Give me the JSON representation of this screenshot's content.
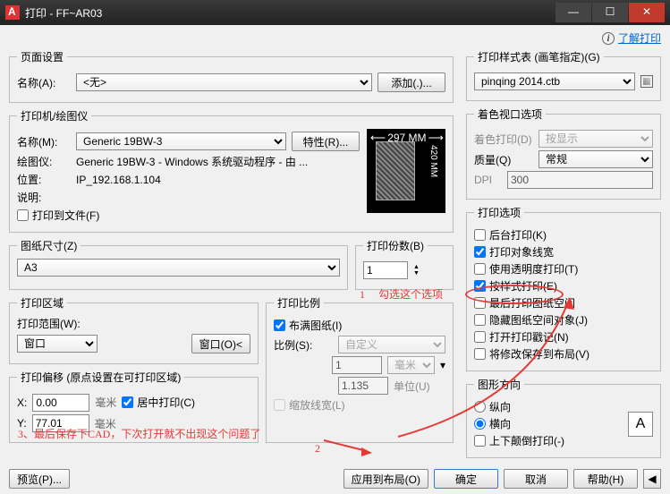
{
  "window": {
    "title": "打印 - FF~AR03"
  },
  "toplink": "了解打印",
  "page_setup": {
    "legend": "页面设置",
    "name_lbl": "名称(A):",
    "name_val": "<无>",
    "add_btn": "添加(.)..."
  },
  "printer": {
    "legend": "打印机/绘图仪",
    "name_lbl": "名称(M):",
    "name_val": "Generic 19BW-3",
    "props_btn": "特性(R)...",
    "plotter_lbl": "绘图仪:",
    "plotter_val": "Generic 19BW-3 - Windows 系统驱动程序 - 由 ...",
    "loc_lbl": "位置:",
    "loc_val": "IP_192.168.1.104",
    "desc_lbl": "说明:",
    "desc_val": "",
    "to_file": "打印到文件(F)",
    "paper_w": "297 MM",
    "paper_h": "420 MM"
  },
  "paper": {
    "legend": "图纸尺寸(Z)",
    "val": "A3"
  },
  "copies": {
    "legend": "打印份数(B)",
    "val": "1"
  },
  "area": {
    "legend": "打印区域",
    "what_lbl": "打印范围(W):",
    "what_val": "窗口",
    "window_btn": "窗口(O)<"
  },
  "scale": {
    "legend": "打印比例",
    "fit": "布满图纸(I)",
    "ratio_lbl": "比例(S):",
    "ratio_val": "自定义",
    "num": "1",
    "num_unit": "毫米",
    "den": "1.135",
    "den_unit": "单位(U)",
    "lw": "缩放线宽(L)"
  },
  "offset": {
    "legend": "打印偏移 (原点设置在可打印区域)",
    "x_lbl": "X:",
    "x_val": "0.00",
    "y_lbl": "Y:",
    "y_val": "77.01",
    "unit": "毫米",
    "center": "居中打印(C)"
  },
  "style": {
    "legend": "打印样式表 (画笔指定)(G)",
    "val": "pinqing 2014.ctb"
  },
  "viewport": {
    "legend": "着色视口选项",
    "shade_lbl": "着色打印(D)",
    "shade_val": "按显示",
    "quality_lbl": "质量(Q)",
    "quality_val": "常规",
    "dpi_lbl": "DPI",
    "dpi_val": "300"
  },
  "options": {
    "legend": "打印选项",
    "bg": "后台打印(K)",
    "lw": "打印对象线宽",
    "trans": "使用透明度打印(T)",
    "style": "按样式打印(E)",
    "last": "最后打印图纸空间",
    "hide": "隐藏图纸空间对象(J)",
    "stamp": "打开打印戳记(N)",
    "save": "将修改保存到布局(V)"
  },
  "orient": {
    "legend": "图形方向",
    "portrait": "纵向",
    "landscape": "横向",
    "upside": "上下颠倒打印(-)"
  },
  "bottom": {
    "preview": "预览(P)...",
    "apply": "应用到布局(O)",
    "ok": "确定",
    "cancel": "取消",
    "help": "帮助(H)"
  },
  "anno": {
    "t1": "1 　勾选这个选项",
    "t2": "2",
    "t3": "3、最后保存下CAD，下次打开就不出现这个问题了"
  }
}
